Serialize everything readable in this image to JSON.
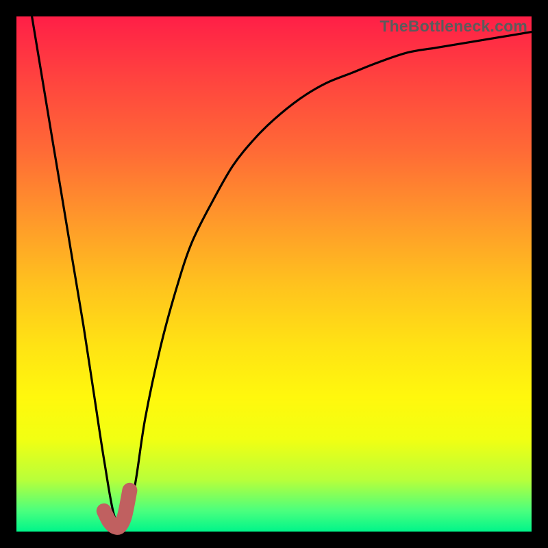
{
  "watermark": "TheBottleneck.com",
  "chart_data": {
    "type": "line",
    "title": "",
    "xlabel": "",
    "ylabel": "",
    "xlim": [
      0,
      100
    ],
    "ylim": [
      0,
      100
    ],
    "grid": false,
    "legend": false,
    "annotations": [],
    "series": [
      {
        "name": "bottleneck-curve",
        "color": "#000000",
        "x": [
          3,
          5,
          7,
          9,
          11,
          13,
          15,
          17,
          19,
          21,
          23,
          25,
          28,
          31,
          34,
          38,
          42,
          46,
          50,
          55,
          60,
          65,
          70,
          76,
          82,
          88,
          94,
          100
        ],
        "y": [
          100,
          88,
          76,
          64,
          52,
          40,
          27,
          14,
          3,
          1,
          9,
          22,
          36,
          47,
          56,
          64,
          71,
          76,
          80,
          84,
          87,
          89,
          91,
          93,
          94,
          95,
          96,
          97
        ]
      },
      {
        "name": "highlight-j-marker",
        "color": "#c06060",
        "x": [
          17,
          18,
          19,
          20,
          21,
          22
        ],
        "y": [
          4,
          2,
          1,
          1,
          3,
          8
        ]
      }
    ],
    "gradient_stops": [
      {
        "pos": 0,
        "color": "#ff1f47"
      },
      {
        "pos": 12,
        "color": "#ff433f"
      },
      {
        "pos": 26,
        "color": "#ff6a36"
      },
      {
        "pos": 40,
        "color": "#ff9a2a"
      },
      {
        "pos": 52,
        "color": "#ffc21e"
      },
      {
        "pos": 64,
        "color": "#ffe314"
      },
      {
        "pos": 74,
        "color": "#fff80d"
      },
      {
        "pos": 82,
        "color": "#f2ff12"
      },
      {
        "pos": 90,
        "color": "#b8ff3a"
      },
      {
        "pos": 96,
        "color": "#4aff7e"
      },
      {
        "pos": 100,
        "color": "#00f58a"
      }
    ]
  }
}
